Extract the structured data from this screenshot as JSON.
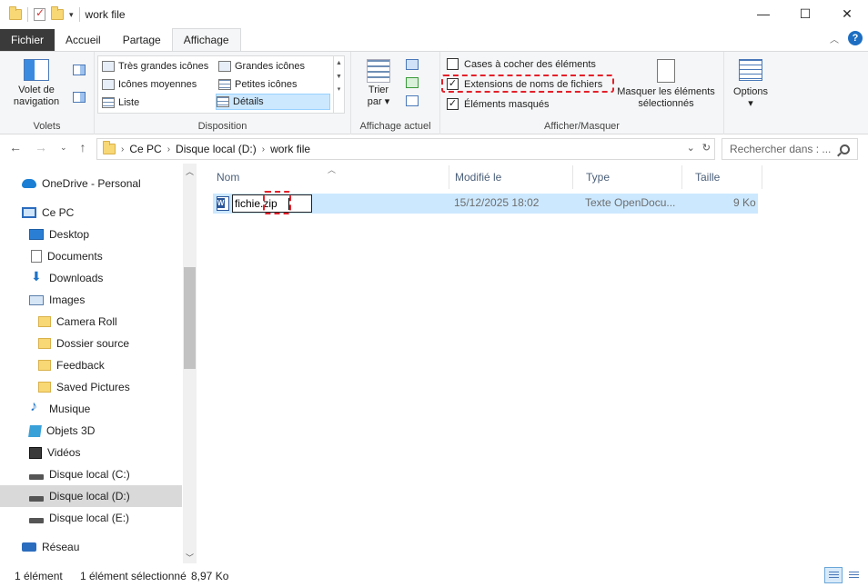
{
  "window": {
    "title": "work file",
    "controls": [
      "—",
      "☐",
      "✕"
    ]
  },
  "tabs": [
    {
      "label": "Fichier"
    },
    {
      "label": "Accueil"
    },
    {
      "label": "Partage"
    },
    {
      "label": "Affichage"
    }
  ],
  "ribbon": {
    "volets": {
      "label": "Volets",
      "nav_pane_line1": "Volet de",
      "nav_pane_line2": "navigation"
    },
    "disposition": {
      "label": "Disposition",
      "items": [
        "Très grandes icônes",
        "Grandes icônes",
        "Icônes moyennes",
        "Petites icônes",
        "Liste",
        "Détails"
      ],
      "selected": "Détails"
    },
    "affichage_actuel": {
      "label": "Affichage actuel",
      "sort_line1": "Trier",
      "sort_line2": "par"
    },
    "afficher_masquer": {
      "label": "Afficher/Masquer",
      "checkboxes": [
        {
          "label": "Cases à cocher des éléments",
          "checked": false
        },
        {
          "label": "Extensions de noms de fichiers",
          "checked": true
        },
        {
          "label": "Éléments masqués",
          "checked": true
        }
      ],
      "hide_line1": "Masquer les éléments",
      "hide_line2": "sélectionnés"
    },
    "options_label": "Options"
  },
  "address": {
    "crumbs": [
      "Ce PC",
      "Disque local (D:)",
      "work file"
    ],
    "search_placeholder": "Rechercher dans : ..."
  },
  "sidebar": {
    "items": [
      {
        "label": "OneDrive - Personal",
        "icon": "cloud-icon"
      },
      {
        "label": "Ce PC",
        "icon": "computer-icon"
      },
      {
        "label": "Desktop",
        "icon": "desktop-icon"
      },
      {
        "label": "Documents",
        "icon": "document-icon"
      },
      {
        "label": "Downloads",
        "icon": "download-icon"
      },
      {
        "label": "Images",
        "icon": "image-icon"
      },
      {
        "label": "Camera Roll",
        "icon": "folder-icon"
      },
      {
        "label": "Dossier source",
        "icon": "folder-icon"
      },
      {
        "label": "Feedback",
        "icon": "folder-icon"
      },
      {
        "label": "Saved Pictures",
        "icon": "folder-icon"
      },
      {
        "label": "Musique",
        "icon": "music-icon"
      },
      {
        "label": "Objets 3D",
        "icon": "cube-icon"
      },
      {
        "label": "Vidéos",
        "icon": "video-icon"
      },
      {
        "label": "Disque local (C:)",
        "icon": "drive-icon"
      },
      {
        "label": "Disque local (D:)",
        "icon": "drive-icon",
        "selected": true
      },
      {
        "label": "Disque local (E:)",
        "icon": "drive-icon"
      },
      {
        "label": "Réseau",
        "icon": "network-icon"
      }
    ]
  },
  "columns": {
    "name": "Nom",
    "modified": "Modifié le",
    "type": "Type",
    "size": "Taille"
  },
  "files": [
    {
      "name_edit": "fichie",
      "name_ext": ".zip",
      "modified": "15/12/2025 18:02",
      "type": "Texte OpenDocu...",
      "size": "9 Ko"
    }
  ],
  "status": {
    "count": "1 élément",
    "selection": "1 élément sélectionné",
    "size": "8,97 Ko"
  },
  "colors": {
    "accent": "#1d6ec2",
    "selection": "#cce8ff",
    "highlight": "#e3202a"
  }
}
